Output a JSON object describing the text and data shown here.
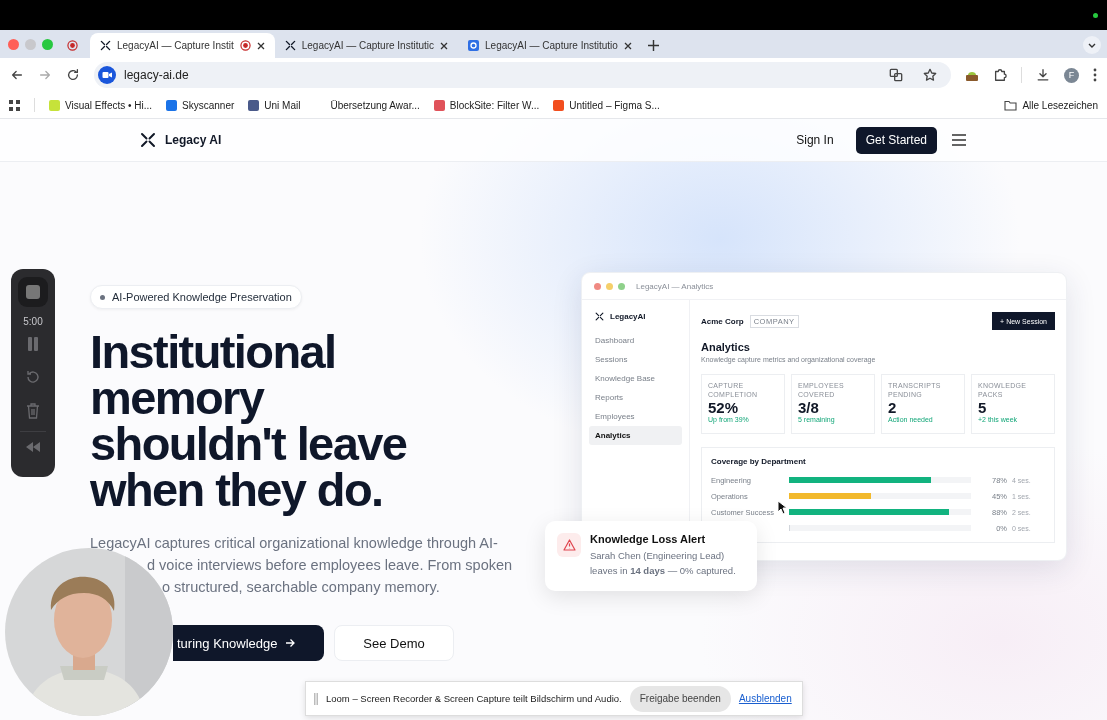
{
  "browser": {
    "tabs": [
      {
        "title": "LegacyAI — Capture Instit",
        "selected": true,
        "recording": true,
        "kind": "logo"
      },
      {
        "title": "LegacyAI — Capture Institutic",
        "selected": false,
        "recording": false,
        "kind": "logo"
      },
      {
        "title": "LegacyAI — Capture Institutio",
        "selected": false,
        "recording": false,
        "kind": "app"
      }
    ],
    "url": "legacy-ai.de",
    "profile_initial": "F",
    "bookmarks": [
      {
        "label": "Visual Effects • Hi...",
        "color": "#c6e23a"
      },
      {
        "label": "Skyscanner",
        "color": "#1b73e8"
      },
      {
        "label": "Uni Mail",
        "color": "#4a5a8a"
      },
      {
        "label": "Übersetzung Awar..."
      },
      {
        "label": "BlockSite: Filter W...",
        "color": "#e0525a"
      },
      {
        "label": "Untitled – Figma S...",
        "color": "#f24e1e"
      }
    ],
    "all_bookmarks": "Alle Lesezeichen"
  },
  "nav": {
    "brand": "Legacy AI",
    "sign_in": "Sign In",
    "get_started": "Get Started"
  },
  "hero": {
    "badge": "AI-Powered Knowledge Preservation",
    "heading_lines": [
      "Institutional",
      "memory",
      "shouldn't leave",
      "when they do."
    ],
    "paragraph_lines": [
      "LegacyAI captures critical organizational knowledge through AI-",
      "d voice interviews before employees leave. From spoken",
      "o structured, searchable company memory."
    ],
    "primary_button": "turing Knowledge",
    "secondary_button": "See Demo"
  },
  "app_preview": {
    "title": "LegacyAI — Analytics",
    "brand": "LegacyAI",
    "sidebar": [
      {
        "label": "Dashboard",
        "selected": false
      },
      {
        "label": "Sessions",
        "selected": false
      },
      {
        "label": "Knowledge Base",
        "selected": false
      },
      {
        "label": "Reports",
        "selected": false
      },
      {
        "label": "Employees",
        "selected": false
      },
      {
        "label": "Analytics",
        "selected": true
      }
    ],
    "company": "Acme Corp",
    "company_tag": "COMPANY",
    "new_session": "+ New Session",
    "heading": "Analytics",
    "subtitle": "Knowledge capture metrics and organizational coverage",
    "stats": [
      {
        "label": "CAPTURE COMPLETION",
        "value": "52%",
        "note": "Up from 39%"
      },
      {
        "label": "EMPLOYEES COVERED",
        "value": "3/8",
        "note": "5 remaining"
      },
      {
        "label": "TRANSCRIPTS PENDING",
        "value": "2",
        "note": "Action needed"
      },
      {
        "label": "KNOWLEDGE PACKS",
        "value": "5",
        "note": "+2 this week"
      }
    ],
    "coverage_title": "Coverage by Department",
    "departments": [
      {
        "name": "Engineering",
        "level": 0.78,
        "percent": "78%",
        "sessions": "4 ses.",
        "color": "#12b37f"
      },
      {
        "name": "Operations",
        "level": 0.45,
        "percent": "45%",
        "sessions": "1 ses.",
        "color": "#f2b92c"
      },
      {
        "name": "Customer Success",
        "level": 0.88,
        "percent": "88%",
        "sessions": "2 ses.",
        "color": "#12b37f"
      },
      {
        "level": 0,
        "percent": "0%",
        "sessions": "0 ses."
      }
    ]
  },
  "alert": {
    "title": "Knowledge Loss Alert",
    "text": "Sarah Chen (Engineering Lead) leaves in **14 days** — 0% captured."
  },
  "recorder": {
    "timer": "5:00"
  },
  "share_banner": {
    "text": "Loom – Screen Recorder & Screen Capture teilt Bildschirm und Audio.",
    "stop_button": "Freigabe beenden",
    "hide_link": "Ausblenden"
  }
}
